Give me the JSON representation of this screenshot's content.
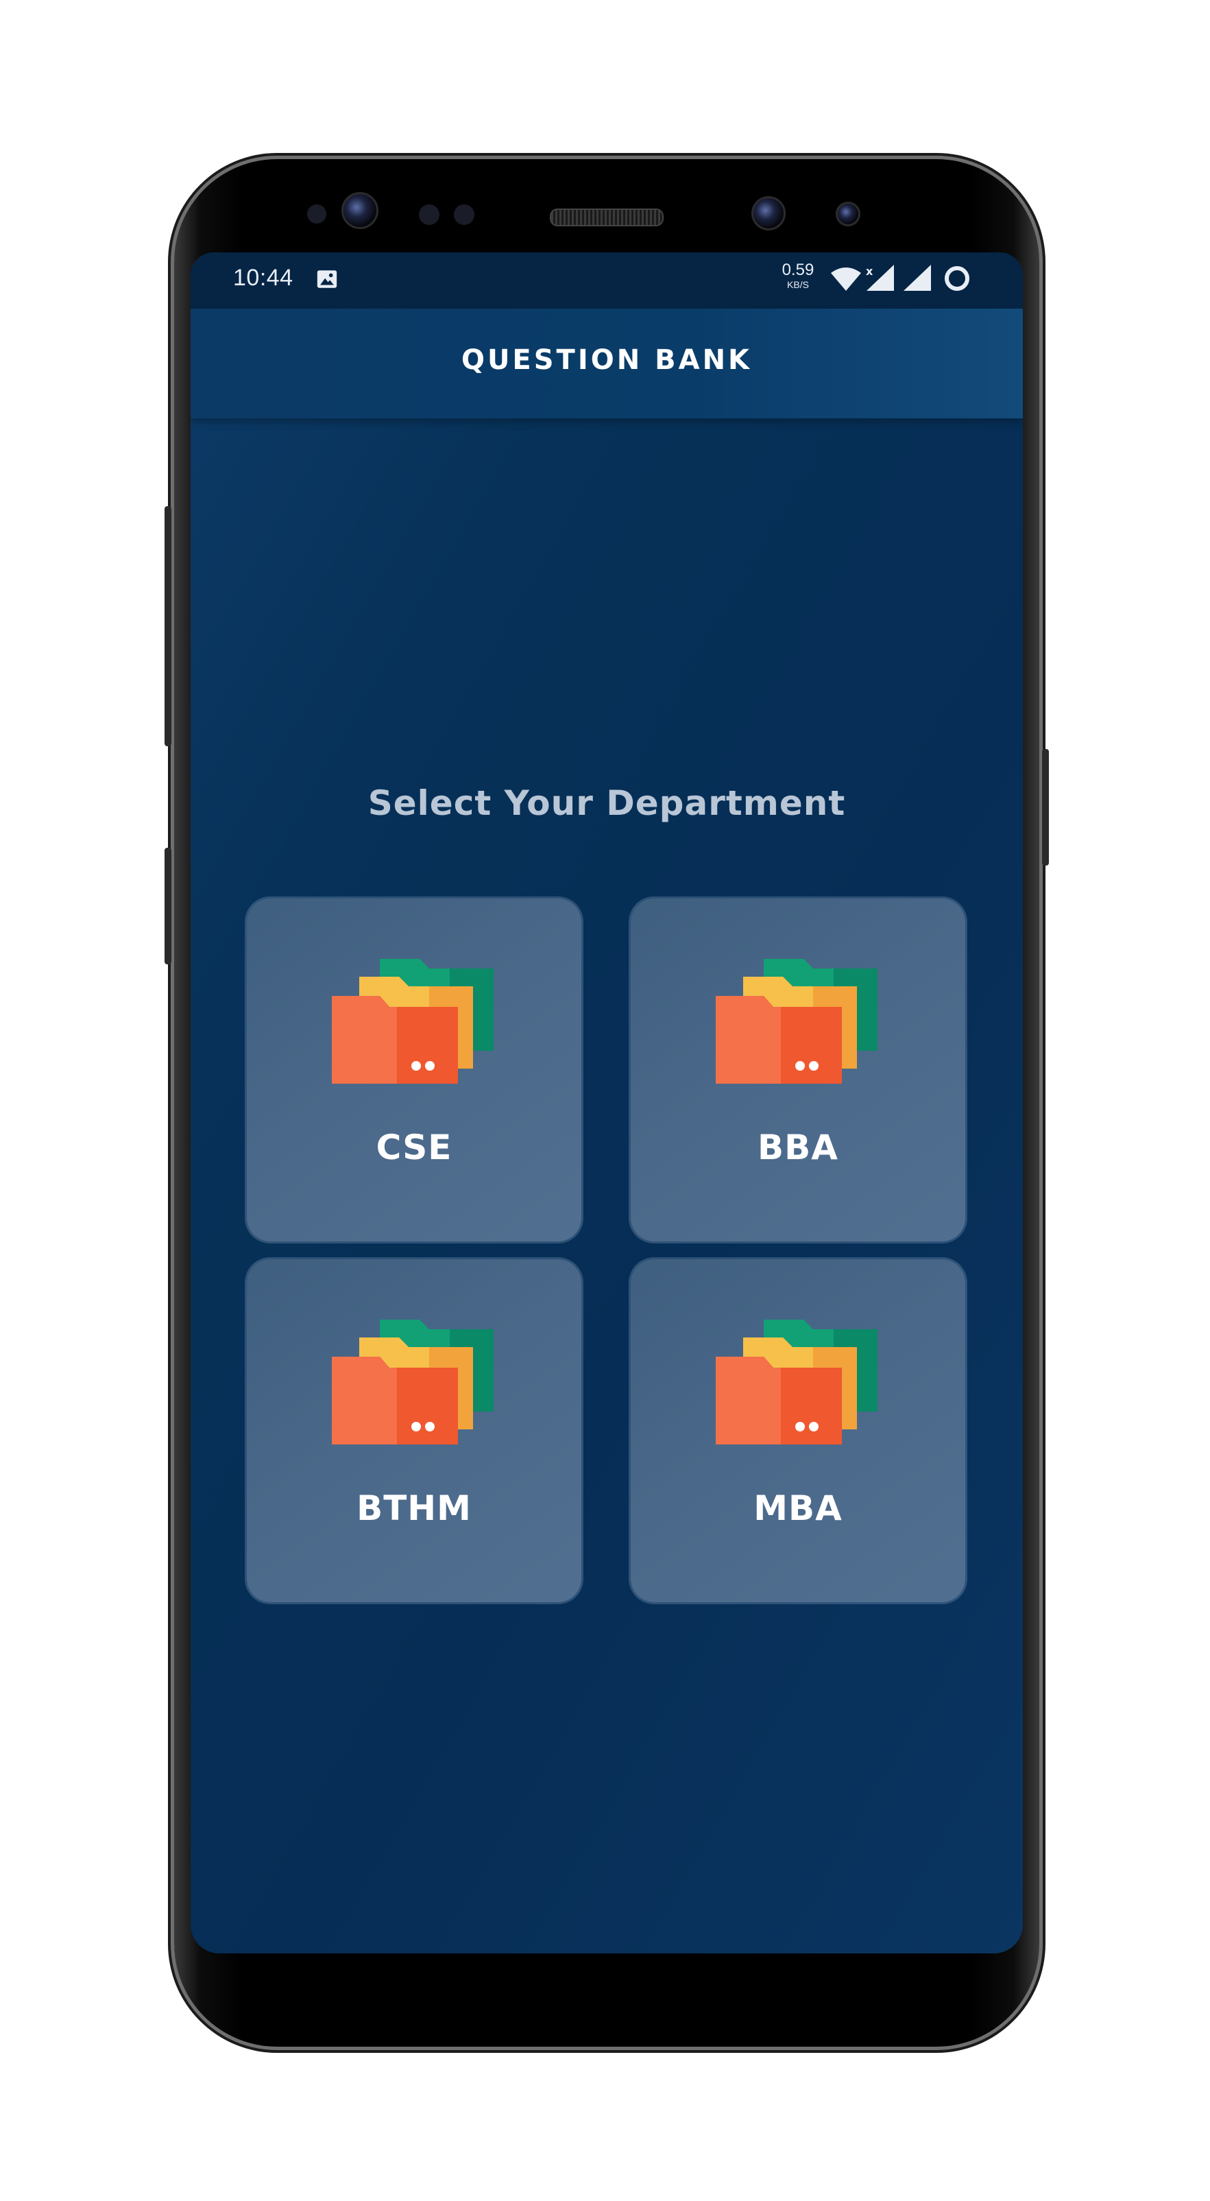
{
  "status_bar": {
    "time": "10:44",
    "net_speed_value": "0.59",
    "net_speed_unit": "KB/S",
    "icons": [
      "image-icon",
      "wifi-icon",
      "signal-x-icon",
      "signal-icon",
      "sync-ring-icon"
    ]
  },
  "app_bar": {
    "title": "QUESTION BANK"
  },
  "main": {
    "heading": "Select Your Department",
    "departments": [
      {
        "label": "CSE",
        "icon": "folder-stack-icon"
      },
      {
        "label": "BBA",
        "icon": "folder-stack-icon"
      },
      {
        "label": "BTHM",
        "icon": "folder-stack-icon"
      },
      {
        "label": "MBA",
        "icon": "folder-stack-icon"
      }
    ]
  },
  "colors": {
    "background": "#062d55",
    "app_bar": "#0a3c69",
    "card": "#4a6889",
    "heading_text": "#b9c6d6",
    "folder_red": "#f0582f",
    "folder_orange": "#f4714a",
    "folder_yellow": "#f6b43e",
    "folder_green": "#109e6e"
  }
}
